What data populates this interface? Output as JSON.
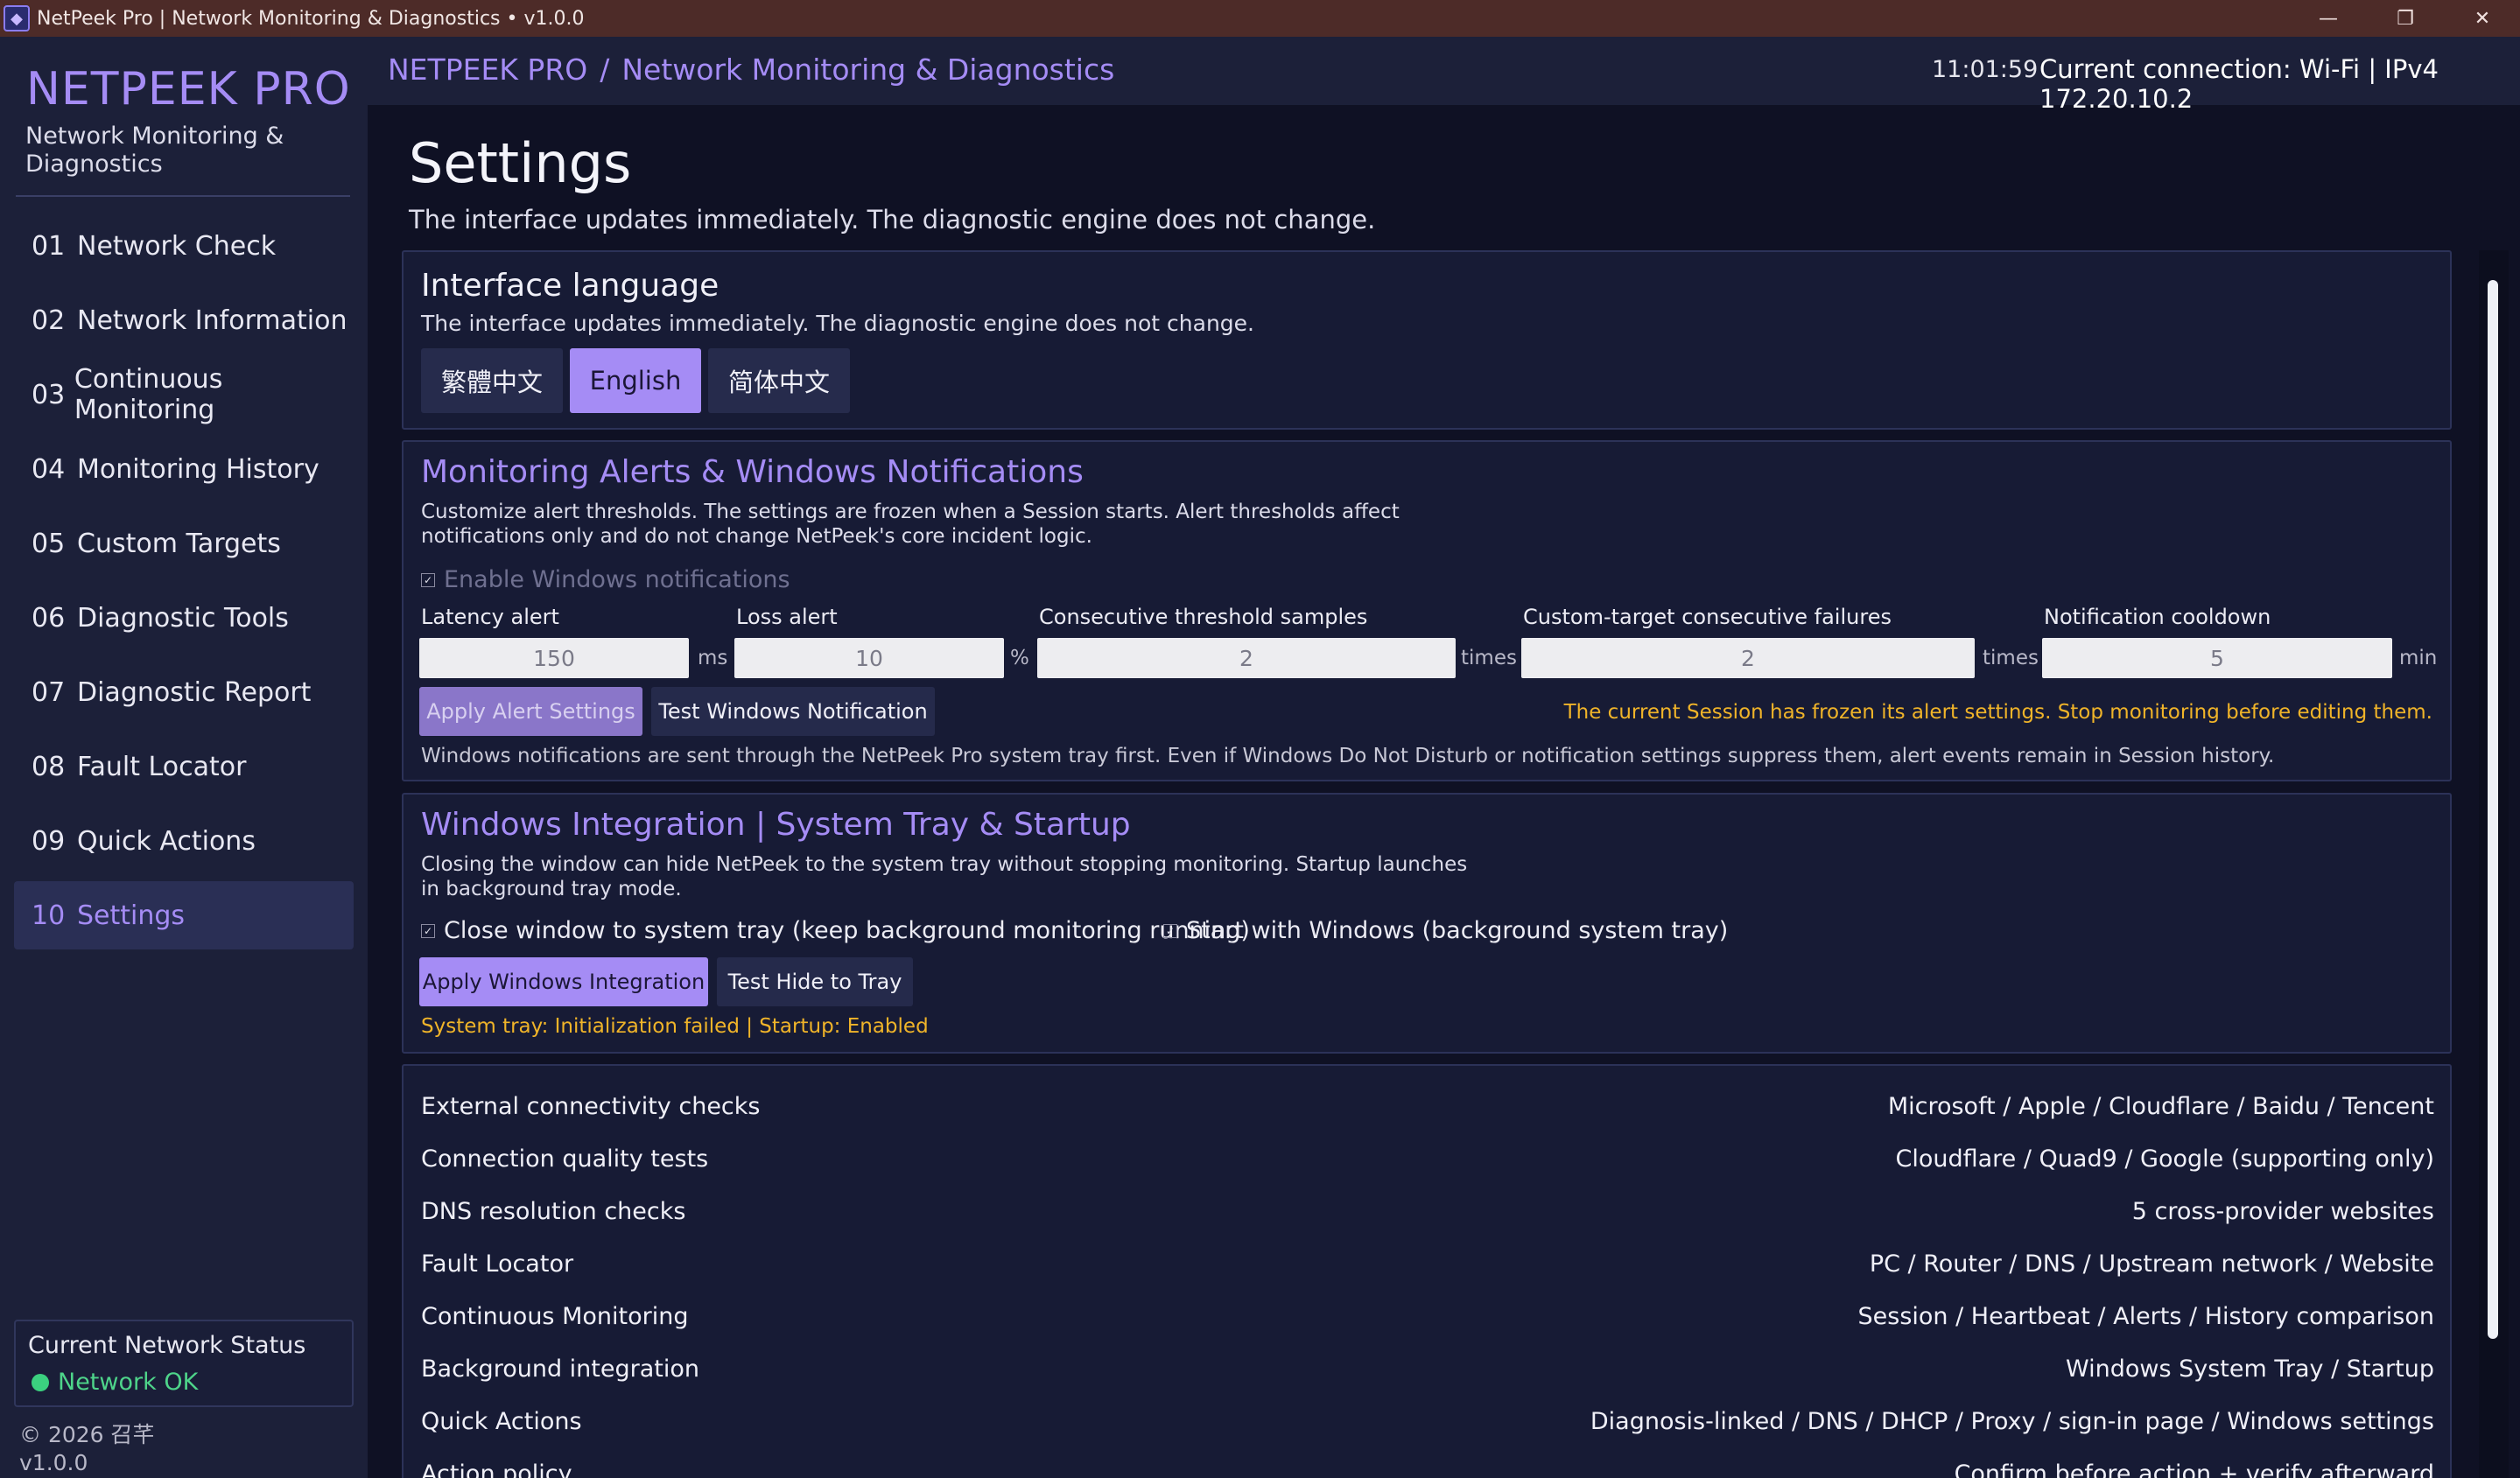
{
  "window": {
    "title": "NetPeek Pro | Network Monitoring & Diagnostics  •  v1.0.0",
    "app_icon": "netpeek-app-icon",
    "controls": {
      "minimize": "—",
      "restore": "❐",
      "close": "✕"
    }
  },
  "sidebar": {
    "brand": "NETPEEK PRO",
    "brand_sub": "Network Monitoring & Diagnostics",
    "items": [
      {
        "num": "01",
        "label": "Network Check"
      },
      {
        "num": "02",
        "label": "Network Information"
      },
      {
        "num": "03",
        "label": "Continuous Monitoring"
      },
      {
        "num": "04",
        "label": "Monitoring History"
      },
      {
        "num": "05",
        "label": "Custom Targets"
      },
      {
        "num": "06",
        "label": "Diagnostic Tools"
      },
      {
        "num": "07",
        "label": "Diagnostic Report"
      },
      {
        "num": "08",
        "label": "Fault Locator"
      },
      {
        "num": "09",
        "label": "Quick Actions"
      },
      {
        "num": "10",
        "label": "Settings"
      }
    ],
    "active_index": 9,
    "status_title": "Current Network Status",
    "status_text": "Network OK",
    "status_color": "#3bd07f",
    "copyright": "© 2026 召芊",
    "version": "v1.0.0"
  },
  "header": {
    "crumb_root": "NETPEEK PRO",
    "crumb_sep": "/",
    "crumb_page": "Network Monitoring & Diagnostics",
    "clock": "11:01:59",
    "connection": "Current connection: Wi-Fi | IPv4 172.20.10.2"
  },
  "page": {
    "title": "Settings",
    "subtitle": "The interface updates immediately. The diagnostic engine does not change."
  },
  "language": {
    "heading": "Interface language",
    "desc": "The interface updates immediately. The diagnostic engine does not change.",
    "options": [
      "繁體中文",
      "English",
      "简体中文"
    ],
    "selected": "English"
  },
  "alerts": {
    "heading": "Monitoring Alerts & Windows Notifications",
    "desc_line1": "Customize alert thresholds. The settings are frozen when a Session starts. Alert thresholds affect",
    "desc_line2": "notifications only and do not change NetPeek's core incident logic.",
    "enable_label": "Enable Windows notifications",
    "enable_checked": true,
    "fields": [
      {
        "label": "Latency alert",
        "value": "150",
        "unit": "ms"
      },
      {
        "label": "Loss alert",
        "value": "10",
        "unit": "%"
      },
      {
        "label": "Consecutive threshold samples",
        "value": "2",
        "unit": "times"
      },
      {
        "label": "Custom-target consecutive failures",
        "value": "2",
        "unit": "times"
      },
      {
        "label": "Notification cooldown",
        "value": "5",
        "unit": "min"
      }
    ],
    "apply_label": "Apply Alert Settings",
    "test_label": "Test Windows Notification",
    "frozen_warning": "The current Session has frozen its alert settings. Stop monitoring before editing them.",
    "footnote": "Windows notifications are sent through the NetPeek Pro system tray first. Even if Windows Do Not Disturb or notification settings suppress them, alert events remain in Session history."
  },
  "integration": {
    "heading": "Windows Integration | System Tray & Startup",
    "desc_line1": "Closing the window can hide NetPeek to the system tray without stopping monitoring. Startup launches",
    "desc_line2": "in background tray mode.",
    "close_to_tray_label": "Close window to system tray (keep background monitoring running)",
    "close_to_tray_checked": true,
    "startup_label": "Start with Windows (background system tray)",
    "startup_checked": true,
    "apply_label": "Apply Windows Integration",
    "test_label": "Test Hide to Tray",
    "status": "System tray: Initialization failed | Startup: Enabled"
  },
  "info_rows": [
    {
      "key": "External connectivity checks",
      "value": "Microsoft / Apple / Cloudflare / Baidu / Tencent"
    },
    {
      "key": "Connection quality tests",
      "value": "Cloudflare / Quad9 / Google (supporting only)"
    },
    {
      "key": "DNS resolution checks",
      "value": "5 cross-provider websites"
    },
    {
      "key": "Fault Locator",
      "value": "PC / Router / DNS / Upstream network / Website"
    },
    {
      "key": "Continuous Monitoring",
      "value": "Session / Heartbeat / Alerts / History comparison"
    },
    {
      "key": "Background integration",
      "value": "Windows System Tray / Startup"
    },
    {
      "key": "Quick Actions",
      "value": "Diagnosis-linked / DNS / DHCP / Proxy / sign-in page / Windows settings"
    },
    {
      "key": "Action policy",
      "value": "Confirm before action + verify afterward"
    }
  ],
  "colors": {
    "accent": "#a58cf5",
    "warning": "#f0b429",
    "ok": "#3bd07f",
    "background": "#0f1124",
    "panel": "#1c2039"
  }
}
